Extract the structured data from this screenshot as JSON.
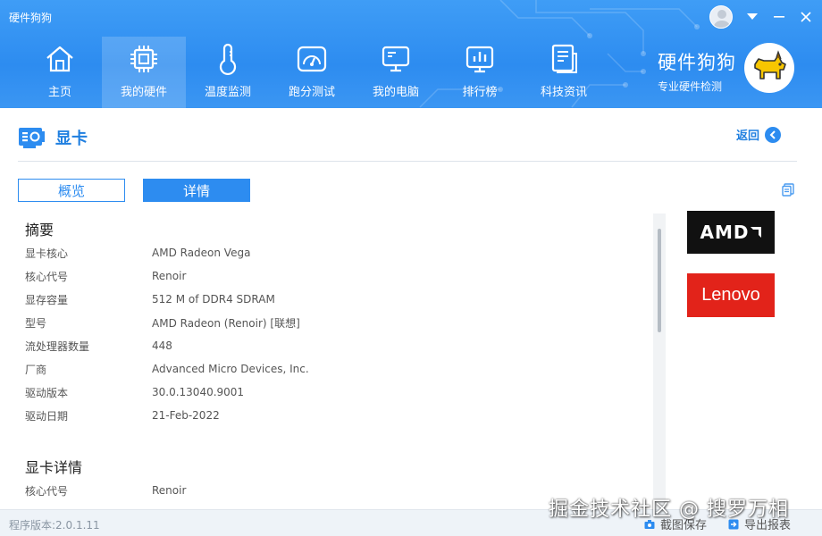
{
  "window": {
    "title": "硬件狗狗"
  },
  "nav": [
    {
      "label": "主页",
      "icon": "home-icon"
    },
    {
      "label": "我的硬件",
      "icon": "chip-icon",
      "active": true
    },
    {
      "label": "温度监测",
      "icon": "thermometer-icon"
    },
    {
      "label": "跑分测试",
      "icon": "speedometer-icon"
    },
    {
      "label": "我的电脑",
      "icon": "monitor-icon"
    },
    {
      "label": "排行榜",
      "icon": "chart-icon"
    },
    {
      "label": "科技资讯",
      "icon": "news-icon"
    }
  ],
  "brand": {
    "name": "硬件狗狗",
    "tagline": "专业硬件检测"
  },
  "section": {
    "title": "显卡",
    "back_label": "返回"
  },
  "tabs": {
    "overview": "概览",
    "detail": "详情",
    "active": "detail"
  },
  "summary": {
    "title": "摘要",
    "rows": [
      {
        "key": "显卡核心",
        "value": "AMD Radeon Vega"
      },
      {
        "key": "核心代号",
        "value": "Renoir"
      },
      {
        "key": "显存容量",
        "value": "512 M of DDR4 SDRAM"
      },
      {
        "key": "型号",
        "value": "AMD Radeon (Renoir) [联想]"
      },
      {
        "key": "流处理器数量",
        "value": "448"
      },
      {
        "key": "厂商",
        "value": "Advanced Micro Devices, Inc."
      },
      {
        "key": "驱动版本",
        "value": "30.0.13040.9001"
      },
      {
        "key": "驱动日期",
        "value": "21-Feb-2022"
      }
    ]
  },
  "gpu_detail": {
    "title": "显卡详情",
    "rows": [
      {
        "key": "核心代号",
        "value": "Renoir"
      }
    ]
  },
  "logos": {
    "vendor": "AMD",
    "oem": "Lenovo"
  },
  "footer": {
    "version": "程序版本:2.0.1.11",
    "screenshot_label": "截图保存",
    "export_label": "导出报表"
  },
  "watermark": "掘金技术社区 @ 搜罗万相",
  "colors": {
    "primary": "#2d8cf0",
    "amd": "#111111",
    "lenovo": "#e2231a"
  }
}
